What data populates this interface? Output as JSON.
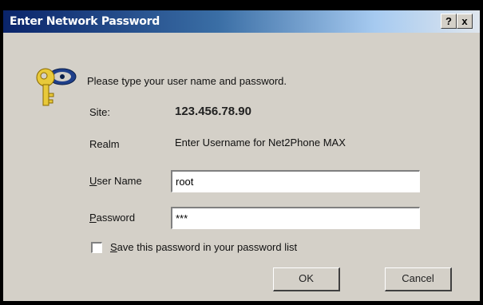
{
  "window": {
    "title": "Enter Network Password",
    "help_label": "?",
    "close_label": "x"
  },
  "dialog": {
    "prompt": "Please type your user name and password.",
    "site_label": "Site:",
    "site_value": "123.456.78.90",
    "realm_label": "Realm",
    "realm_value": "Enter Username for Net2Phone MAX",
    "user_label": "User Name",
    "user_value": "root",
    "password_label": "Password",
    "password_value": "***",
    "save_label": "Save this password in your password list",
    "save_checked": false,
    "ok_label": "OK",
    "cancel_label": "Cancel"
  },
  "icons": {
    "dialog_icon": "key-icon"
  }
}
